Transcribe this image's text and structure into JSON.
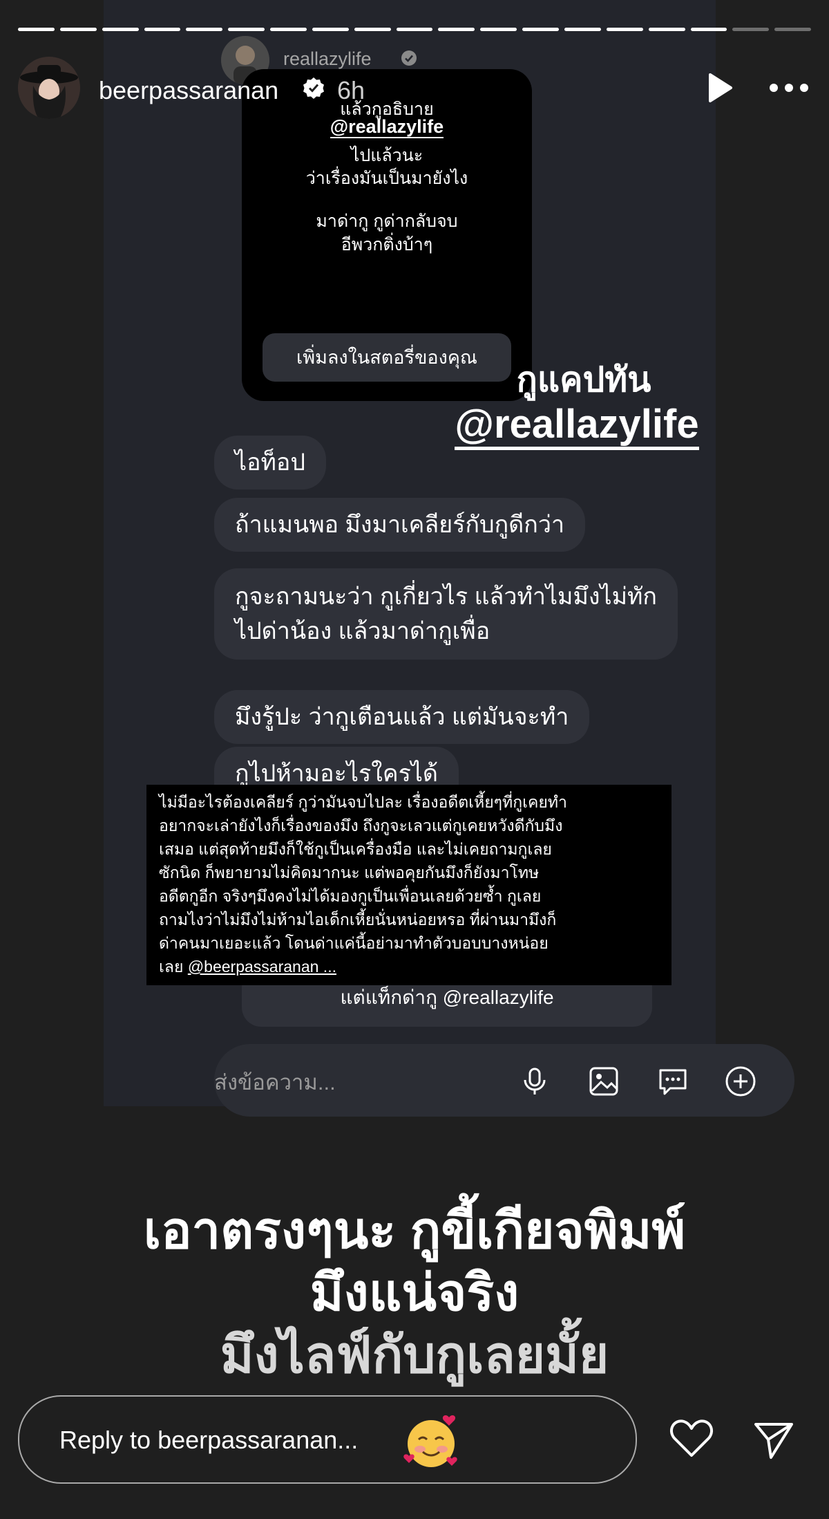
{
  "progress": {
    "segments": 19,
    "completed": 17
  },
  "header": {
    "username": "beerpassaranan",
    "time": "6h",
    "verified": true
  },
  "screenshot": {
    "account_name": "reallazylife",
    "story_card": {
      "line1": "แล้วกูอธิบาย",
      "mention": "@reallazylife",
      "line2": "ไปแล้วนะ",
      "line3": "ว่าเรื่องมันเป็นมายังไง",
      "line4": "มาด่ากู กูด่ากลับจบ",
      "line5": "อีพวกติ่งบ้าๆ",
      "add_button": "เพิ่มลงในสตอรี่ของคุณ"
    },
    "overlay": {
      "line1": "กูแคปทัน",
      "mention": "@reallazylife"
    },
    "messages": [
      "ไอท็อป",
      "ถ้าแมนพอ มึงมาเคลียร์กับกูดีกว่า",
      "กูจะถามนะว่า กูเกี่ยวไร แล้วทำไมมึงไม่ทัก",
      "ไปด่าน้อง แล้วมาด่ากูเพื่อ",
      "มึงรู้ปะ ว่ากูเตือนแล้ว แต่มันจะทำ",
      "กูไปห้ามอะไรใครได้"
    ],
    "caption_lines": [
      "ไม่มีอะไรต้องเคลียร์ กูว่ามันจบไปละ เรื่องอดีตเหี้ยๆที่กูเคยทำ",
      "อยากจะเล่ายังไงก็เรื่องของมึง ถึงกูจะเลวแต่กูเคยหวังดีกับมึง",
      "เสมอ แต่สุดท้ายมึงก็ใช้กูเป็นเครื่องมือ และไม่เคยถามกูเลย",
      "ซักนิด ก็พยายามไม่คิดมากนะ แต่พอคุยกันมึงก็ยังมาโทษ",
      "อดีตกูอีก จริงๆมึงคงไม่ได้มองกูเป็นเพื่อนเลยด้วยซ้ำ กูเลย",
      "ถามไงว่าไม่มึงไม่ห้ามไอเด็กเหี้ยนั่นหน่อยหรอ ที่ผ่านมามึงก็",
      "ด่าคนมาเยอะแล้ว โดนด่าแค่นี้อย่ามาทำตัวบอบบางหน่อย",
      "เลย"
    ],
    "caption_mention": "@beerpassaranan ...",
    "reply_card": "แต่แท็กด่ากู @reallazylife",
    "composer_placeholder": "ส่งข้อความ..."
  },
  "big_text": {
    "line1": "เอาตรงๆนะ กูขี้เกียจพิมพ์",
    "line2": "มึงแน่จริง",
    "line3": "มึงไลฟ์กับกูเลยมั้ย"
  },
  "footer": {
    "reply_placeholder": "Reply to beerpassaranan...",
    "emoji": "smiling-face-with-hearts"
  }
}
